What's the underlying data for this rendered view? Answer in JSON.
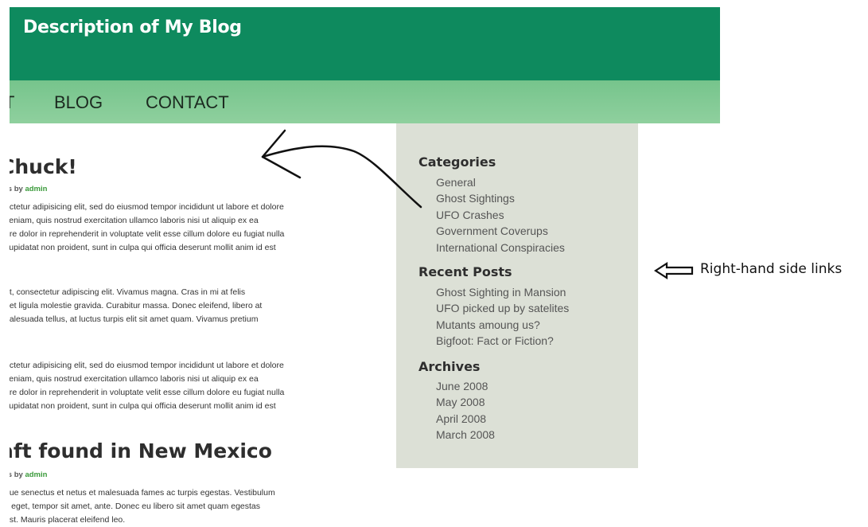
{
  "header": {
    "title": "Description of My Blog",
    "bg_color": "#0e8a5e",
    "nav_bg_color": "#82ca96"
  },
  "nav": {
    "items": [
      {
        "label": "T"
      },
      {
        "label": "BLOG"
      },
      {
        "label": "CONTACT"
      }
    ]
  },
  "posts": [
    {
      "title": "Chuck!",
      "meta_prefix": "ns by ",
      "author": "admin",
      "paragraphs": [
        [
          "ectetur adipisicing elit, sed do eiusmod tempor incididunt ut labore et dolore",
          "veniam, quis nostrud exercitation ullamco laboris nisi ut aliquip ex ea",
          "ure dolor in reprehenderit in voluptate velit esse cillum dolore eu fugiat nulla",
          "cupidatat non proident, sunt in culpa qui officia deserunt mollit anim id est"
        ],
        [
          "et, consectetur adipiscing elit. Vivamus magna. Cras in mi at felis",
          "get ligula molestie gravida. Curabitur massa. Donec eleifend, libero at",
          "nalesuada tellus, at luctus turpis elit sit amet quam. Vivamus pretium"
        ],
        [
          "ectetur adipisicing elit, sed do eiusmod tempor incididunt ut labore et dolore",
          "veniam, quis nostrud exercitation ullamco laboris nisi ut aliquip ex ea",
          "ure dolor in reprehenderit in voluptate velit esse cillum dolore eu fugiat nulla",
          "cupidatat non proident, sunt in culpa qui officia deserunt mollit anim id est"
        ]
      ]
    },
    {
      "title": "aft found in New Mexico",
      "meta_prefix": "ns by ",
      "author": "admin",
      "paragraphs": [
        [
          "que senectus et netus et malesuada fames ac turpis egestas. Vestibulum",
          "s eget, tempor sit amet, ante. Donec eu libero sit amet quam egestas",
          "est. Mauris placerat eleifend leo."
        ]
      ]
    }
  ],
  "sidebar": {
    "bg_color": "#dce0d6",
    "categories": {
      "heading": "Categories",
      "items": [
        "General",
        "Ghost Sightings",
        "UFO Crashes",
        "Government Coverups",
        "International Conspiracies"
      ]
    },
    "recent_posts": {
      "heading": "Recent Posts",
      "items": [
        "Ghost Sighting in Mansion",
        "UFO picked up by satelites",
        "Mutants amoung us?",
        "Bigfoot: Fact or Fiction?"
      ]
    },
    "archives": {
      "heading": "Archives",
      "items": [
        "June 2008",
        "May 2008",
        "April 2008",
        "March 2008"
      ]
    }
  },
  "annotation": {
    "label": "Right-hand side links",
    "arrow_icon": "left-arrow-outline-icon"
  }
}
